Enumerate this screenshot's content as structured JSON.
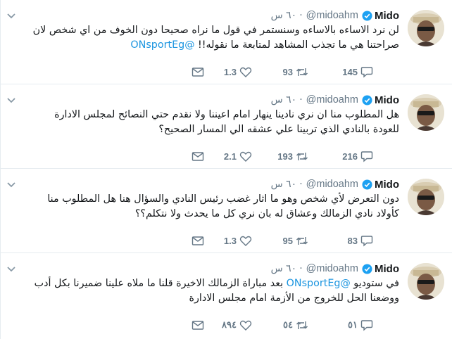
{
  "tweets": [
    {
      "name": "Mido",
      "handle": "@midoahm",
      "time": "٦٠ س",
      "text_lines": [
        "لن نرد الاساءه بالاساءه وسنستمر في قول ما نراه صحيحا دون الخوف من اي شخص لان",
        "صراحتنا هي ما تجذب المشاهد لمتابعة ما نقوله!! "
      ],
      "mention": "@ONsportEg",
      "reply_count": "145",
      "retweet_count": "93",
      "like_count": "1.3"
    },
    {
      "name": "Mido",
      "handle": "@midoahm",
      "time": "٦٠ س",
      "text_lines": [
        "هل المطلوب منا ان نري نادينا ينهار امام اعيننا ولا نقدم حتي النصائح لمجلس الادارة",
        "للعودة بالنادي الذي تربينا علي عشقه الي المسار الصحيح؟"
      ],
      "mention": "",
      "reply_count": "216",
      "retweet_count": "193",
      "like_count": "2.1"
    },
    {
      "name": "Mido",
      "handle": "@midoahm",
      "time": "٦٠ س",
      "text_lines": [
        "دون التعرض لأي شخص وهو ما اثار غضب رئيس النادي والسؤال هنا هل المطلوب منا",
        "كأولاد نادي الزمالك وعشاق له بان نري كل ما يحدث ولا نتكلم؟؟"
      ],
      "mention": "",
      "reply_count": "83",
      "retweet_count": "95",
      "like_count": "1.3"
    },
    {
      "name": "Mido",
      "handle": "@midoahm",
      "time": "٦٠ س",
      "text_lines": [
        "بعد مباراة الزمالك الاخيرة قلنا ما ملاه علينا ضميرنا بكل أدب",
        "ووضعنا الحل للخروج من الأزمة امام مجلس الادارة"
      ],
      "text_prefix": "في ستوديو ",
      "mention": "@ONsportEg",
      "reply_count": "٥١",
      "retweet_count": "٥٤",
      "like_count": "٨٩٤"
    }
  ],
  "colors": {
    "verified": "#1da1f2",
    "mention": "#1b95e0",
    "meta": "#657786",
    "border": "#e6ecf0"
  },
  "icons": [
    "chevron-down-icon",
    "verified-badge-icon",
    "reply-icon",
    "retweet-icon",
    "like-icon",
    "direct-message-icon"
  ]
}
